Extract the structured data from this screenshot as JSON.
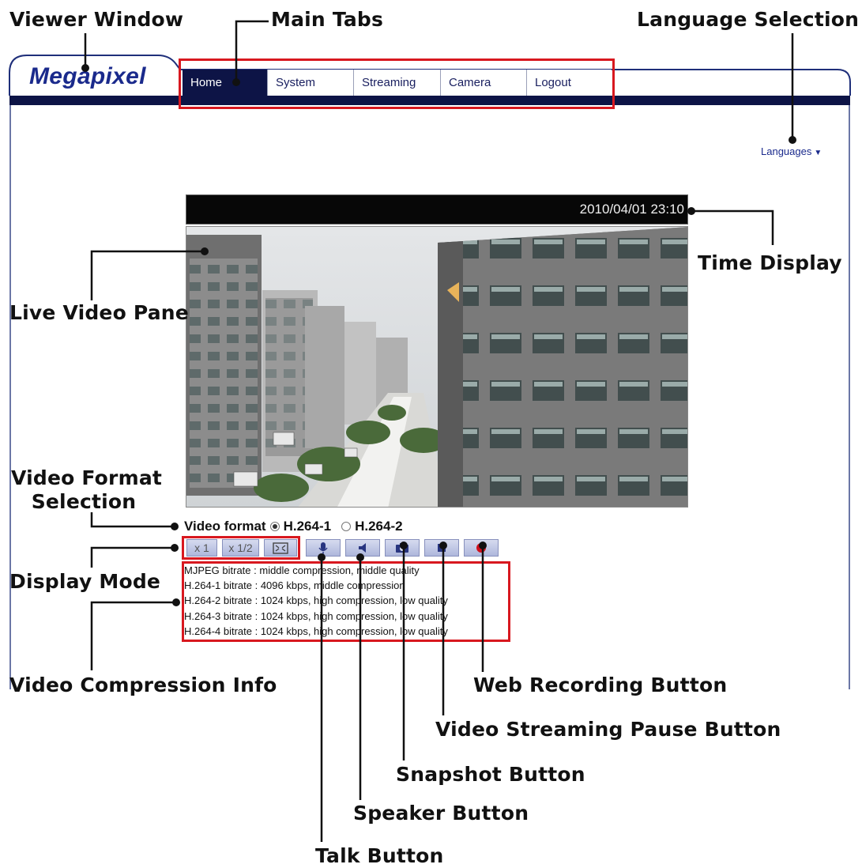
{
  "callouts": {
    "viewer_window": "Viewer Window",
    "main_tabs": "Main Tabs",
    "language_selection": "Language Selection",
    "time_display": "Time Display",
    "live_video_pane": "Live Video Pane",
    "video_format_selection_line1": "Video Format",
    "video_format_selection_line2": "Selection",
    "display_mode": "Display Mode",
    "video_compression_info": "Video Compression Info",
    "web_recording_button": "Web Recording Button",
    "video_streaming_pause_button": "Video Streaming Pause Button",
    "snapshot_button": "Snapshot Button",
    "speaker_button": "Speaker Button",
    "talk_button": "Talk Button"
  },
  "viewer": {
    "logo": "Megapixel",
    "tabs": [
      {
        "label": "Home",
        "active": true
      },
      {
        "label": "System",
        "active": false
      },
      {
        "label": "Streaming",
        "active": false
      },
      {
        "label": "Camera",
        "active": false
      },
      {
        "label": "Logout",
        "active": false
      }
    ],
    "languages_label": "Languages",
    "timestamp": "2010/04/01 23:10",
    "video_format": {
      "label": "Video format",
      "options": [
        {
          "label": "H.264-1",
          "selected": true
        },
        {
          "label": "H.264-2",
          "selected": false
        }
      ]
    },
    "display_mode_buttons": [
      "x 1",
      "x 1/2"
    ],
    "compression_info": [
      "MJPEG bitrate : middle compression, middle quality",
      "H.264-1 bitrate : 4096 kbps, middle compression",
      "H.264-2 bitrate : 1024 kbps, high compression, low quality",
      "H.264-3 bitrate : 1024 kbps, high compression, low quality",
      "H.264-4 bitrate : 1024 kbps, high compression, low quality"
    ]
  },
  "colors": {
    "frame_navy": "#0d1446",
    "highlight_red": "#d8181f",
    "record_red": "#d0101c",
    "logo_blue": "#1a2a8c"
  },
  "icons": [
    "microphone-icon",
    "speaker-icon",
    "camera-icon",
    "stop-icon",
    "record-icon",
    "fullscreen-icon"
  ]
}
